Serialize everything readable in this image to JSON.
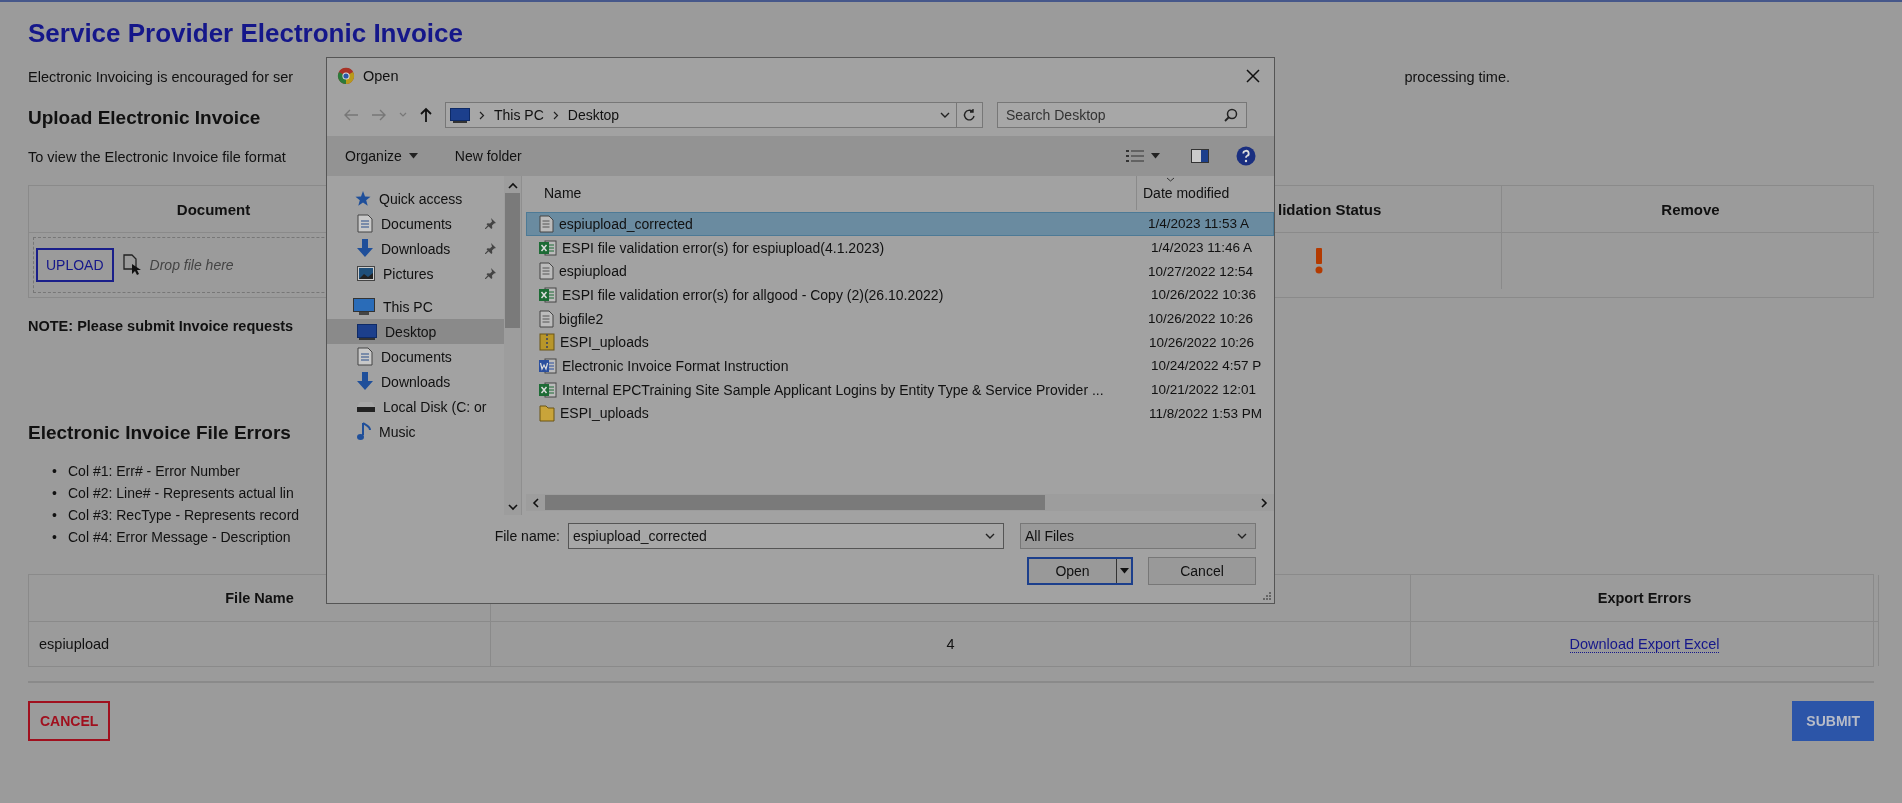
{
  "page": {
    "title": "Service Provider Electronic Invoice",
    "intro_left": "Electronic Invoicing is encouraged for ser",
    "intro_right": "processing time.",
    "upload_heading": "Upload Electronic Invoice",
    "format_note": "To view the Electronic Invoice file format",
    "upload_table": {
      "columns": {
        "document": "Document",
        "validation_status": "lidation Status",
        "remove": "Remove"
      },
      "row": {
        "upload_button": "UPLOAD",
        "drop_hint": "Drop file here",
        "kind": "error"
      }
    },
    "note": "NOTE: Please submit Invoice requests",
    "errors_heading": "Electronic Invoice File Errors",
    "error_columns": [
      {
        "bullet": "•",
        "text": "Col #1: Err# - Error Number"
      },
      {
        "bullet": "•",
        "text": "Col #2: Line# - Represents actual lin"
      },
      {
        "bullet": "•",
        "text": "Col #3: RecType - Represents record"
      },
      {
        "bullet": "•",
        "text": "Col #4: Error Message - Description"
      }
    ],
    "errors_table": {
      "columns": {
        "column_1": "File Name",
        "column_3": "Export Errors"
      },
      "rows": [
        {
          "file_name": "espiupload",
          "column_2": "4",
          "export_link": "Download Export Excel"
        }
      ]
    },
    "buttons": {
      "cancel": "CANCEL",
      "submit": "SUBMIT"
    }
  },
  "dialog": {
    "title": "Open",
    "address": [
      "This PC",
      "Desktop"
    ],
    "search": {
      "placeholder": "Search Desktop"
    },
    "toolbar": {
      "organize": "Organize",
      "new_folder": "New folder"
    },
    "nav": [
      {
        "label": "Quick access",
        "kind": "star",
        "selected": false,
        "children": [
          {
            "label": "Documents",
            "kind": "document",
            "pinned": true,
            "selected": false
          },
          {
            "label": "Downloads",
            "kind": "download",
            "pinned": true,
            "selected": false
          },
          {
            "label": "Pictures",
            "kind": "picture",
            "pinned": true,
            "selected": false
          }
        ]
      },
      {
        "label": "This PC",
        "kind": "pc",
        "selected": false,
        "children": [
          {
            "label": "Desktop",
            "kind": "desktop",
            "pinned": false,
            "selected": true
          },
          {
            "label": "Documents",
            "kind": "document",
            "pinned": false,
            "selected": false
          },
          {
            "label": "Downloads",
            "kind": "download",
            "pinned": false,
            "selected": false
          },
          {
            "label": "Local Disk (C: or",
            "kind": "disk",
            "pinned": false,
            "selected": false
          },
          {
            "label": "Music",
            "kind": "music",
            "pinned": false,
            "selected": false
          }
        ]
      }
    ],
    "columns": {
      "name": "Name",
      "date_modified": "Date modified"
    },
    "files": [
      {
        "name": "espiupload_corrected",
        "date": "1/4/2023 11:53 A",
        "kind": "text",
        "selected": true
      },
      {
        "name": "ESPI file validation error(s) for espiupload(4.1.2023)",
        "date": "1/4/2023 11:46 A",
        "kind": "excel",
        "selected": false
      },
      {
        "name": "espiupload",
        "date": "10/27/2022 12:54",
        "kind": "text",
        "selected": false
      },
      {
        "name": "ESPI file validation error(s) for allgood - Copy (2)(26.10.2022)",
        "date": "10/26/2022 10:36",
        "kind": "excel",
        "selected": false
      },
      {
        "name": "bigfile2",
        "date": "10/26/2022 10:26",
        "kind": "text",
        "selected": false
      },
      {
        "name": "ESPI_uploads",
        "date": "10/26/2022 10:26",
        "kind": "zip",
        "selected": false
      },
      {
        "name": "Electronic Invoice Format Instruction",
        "date": "10/24/2022 4:57 P",
        "kind": "word",
        "selected": false
      },
      {
        "name": "Internal EPCTraining Site Sample Applicant Logins by Entity Type & Service Provider ...",
        "date": "10/21/2022 12:01",
        "kind": "excel",
        "selected": false
      },
      {
        "name": "ESPI_uploads",
        "date": "11/8/2022 1:53 PM",
        "kind": "folder",
        "selected": false
      }
    ],
    "file_name_label": "File name:",
    "file_name": "espiupload_corrected",
    "file_type": "All Files",
    "buttons": {
      "open": "Open",
      "cancel": "Cancel"
    }
  }
}
